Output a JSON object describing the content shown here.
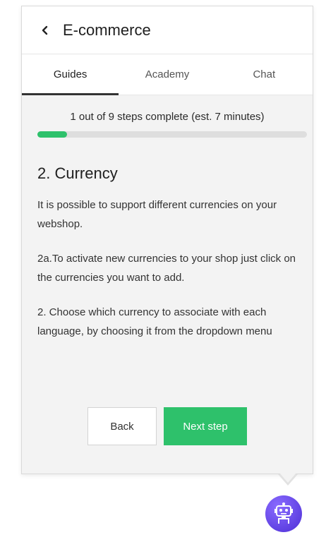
{
  "header": {
    "title": "E-commerce"
  },
  "tabs": [
    {
      "label": "Guides",
      "active": true
    },
    {
      "label": "Academy",
      "active": false
    },
    {
      "label": "Chat",
      "active": false
    }
  ],
  "progress": {
    "text": "1 out of 9 steps complete (est. 7 minutes)",
    "completed_steps": 1,
    "total_steps": 9,
    "fraction": 0.11
  },
  "step": {
    "title": "2. Currency",
    "paragraphs": [
      "It is possible to support different currencies on your webshop.",
      "2a.To activate new currencies to your shop just click on the currencies you want to add.",
      "2. Choose which currency to associate with each language, by choosing it from the dropdown menu"
    ]
  },
  "actions": {
    "back_label": "Back",
    "next_label": "Next step"
  },
  "colors": {
    "accent": "#2ec16b",
    "bot_badge": "#5b3ae6"
  },
  "icons": {
    "back": "chevron-left-icon",
    "assistant": "robot-icon"
  }
}
